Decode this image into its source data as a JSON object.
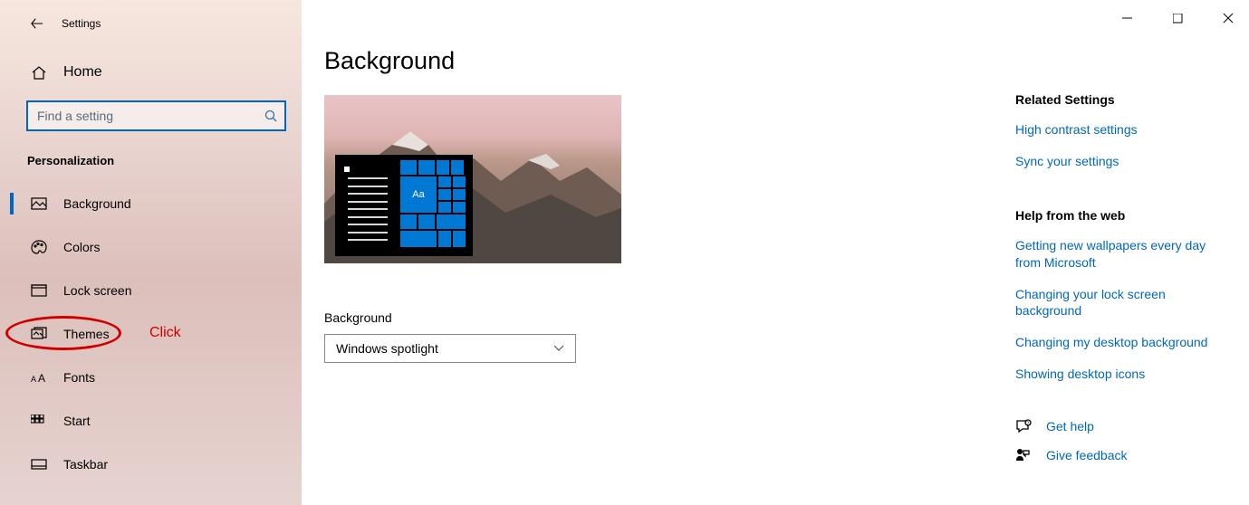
{
  "header": {
    "title": "Settings"
  },
  "home_label": "Home",
  "search": {
    "placeholder": "Find a setting"
  },
  "section": "Personalization",
  "nav": {
    "background": "Background",
    "colors": "Colors",
    "lockscreen": "Lock screen",
    "themes": "Themes",
    "fonts": "Fonts",
    "start": "Start",
    "taskbar": "Taskbar"
  },
  "annotation": {
    "text": "Click"
  },
  "page": {
    "title": "Background",
    "preview_tile_text": "Aa",
    "dropdown_label": "Background",
    "dropdown_value": "Windows spotlight"
  },
  "related": {
    "heading": "Related Settings",
    "links": {
      "contrast": "High contrast settings",
      "sync": "Sync your settings"
    }
  },
  "help": {
    "heading": "Help from the web",
    "links": {
      "wallpapers": "Getting new wallpapers every day from Microsoft",
      "lockbg": "Changing your lock screen background",
      "desktopbg": "Changing my desktop background",
      "icons": "Showing desktop icons"
    }
  },
  "actions": {
    "gethelp": "Get help",
    "feedback": "Give feedback"
  }
}
